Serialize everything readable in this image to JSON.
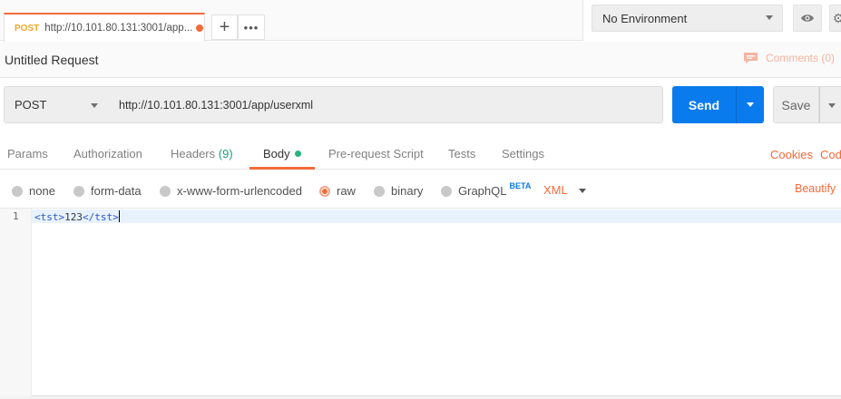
{
  "tabs": [
    {
      "method": "POST",
      "url": "http://10.101.80.131:3001/app...",
      "unsaved": true
    }
  ],
  "tab_actions": {
    "new_tab": "+",
    "more": "•••"
  },
  "environment": {
    "selected": "No Environment"
  },
  "request": {
    "title": "Untitled Request",
    "comments_label": "Comments (0)",
    "method": "POST",
    "url": "http://10.101.80.131:3001/app/userxml"
  },
  "buttons": {
    "send": "Send",
    "save": "Save"
  },
  "request_tabs": [
    {
      "label": "Params"
    },
    {
      "label": "Authorization"
    },
    {
      "label": "Headers",
      "count": "(9)"
    },
    {
      "label": "Body",
      "active": true
    },
    {
      "label": "Pre-request Script"
    },
    {
      "label": "Tests"
    },
    {
      "label": "Settings"
    }
  ],
  "links": {
    "cookies": "Cookies",
    "code": "Code"
  },
  "body_types": [
    {
      "label": "none"
    },
    {
      "label": "form-data"
    },
    {
      "label": "x-www-form-urlencoded"
    },
    {
      "label": "raw",
      "selected": true
    },
    {
      "label": "binary"
    },
    {
      "label": "GraphQL",
      "badge": "BETA"
    }
  ],
  "raw_language": "XML",
  "beautify": "Beautify",
  "editor": {
    "line_number": "1",
    "open_tag": "<tst>",
    "content": "123",
    "close_tag": "</tst>"
  },
  "colors": {
    "accent": "#f26b3a",
    "primary": "#097bed",
    "success": "#26b47f"
  }
}
